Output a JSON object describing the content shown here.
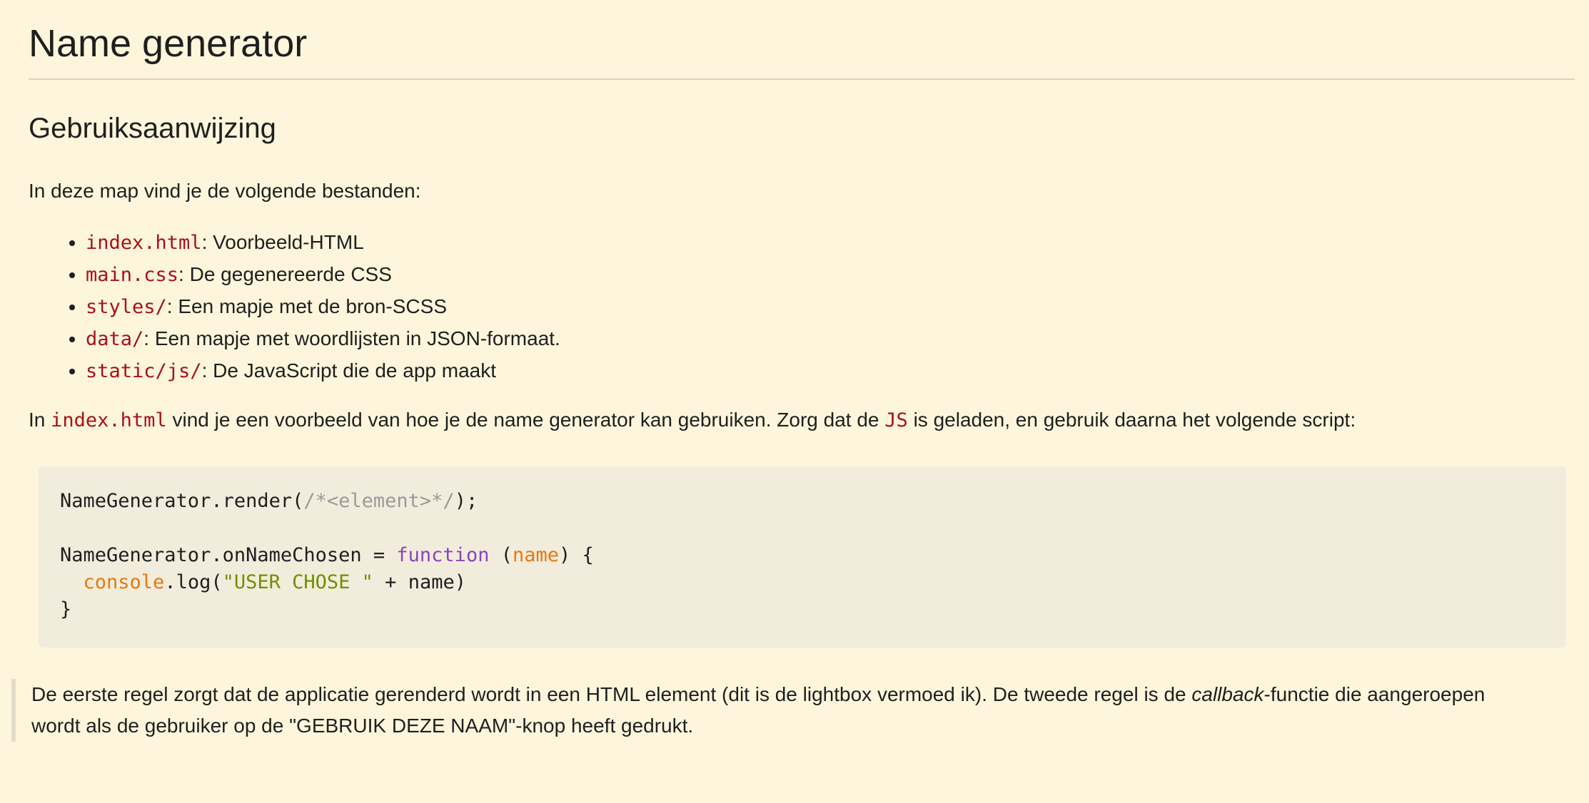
{
  "title": "Name generator",
  "section_title": "Gebruiksaanwijzing",
  "intro": "In deze map vind je de volgende bestanden:",
  "files": [
    {
      "name": "index.html",
      "desc": ": Voorbeeld-HTML"
    },
    {
      "name": "main.css",
      "desc": ": De gegenereerde CSS"
    },
    {
      "name": "styles/",
      "desc": ": Een mapje met de bron-SCSS"
    },
    {
      "name": "data/",
      "desc": ": Een mapje met woordlijsten in JSON-formaat."
    },
    {
      "name": "static/js/",
      "desc": ": De JavaScript die de app maakt"
    }
  ],
  "usage": {
    "prefix": "In ",
    "code1": "index.html",
    "middle": " vind je een voorbeeld van hoe je de name generator kan gebruiken. Zorg dat de ",
    "code2": "JS",
    "suffix": " is geladen, en gebruik daarna het volgende script:"
  },
  "code": {
    "line1_call": "NameGenerator.render(",
    "line1_comment": "/*<element>*/",
    "line1_end": ");",
    "line3_start": "NameGenerator.onNameChosen = ",
    "line3_keyword": "function",
    "line3_open": " (",
    "line3_param": "name",
    "line3_close": ") {",
    "line4_indent": "  ",
    "line4_builtin": "console",
    "line4_call": ".log(",
    "line4_string": "\"USER CHOSE \"",
    "line4_end": " + name)",
    "line5": "}"
  },
  "note": {
    "part1": "De eerste regel zorgt dat de applicatie gerenderd wordt in een HTML element (dit is de lightbox vermoed ik). De tweede regel is de ",
    "emph": "callback",
    "part2": "-functie die aangeroepen wordt als de gebruiker op de \"GEBRUIK DEZE NAAM\"-knop heeft gedrukt."
  }
}
